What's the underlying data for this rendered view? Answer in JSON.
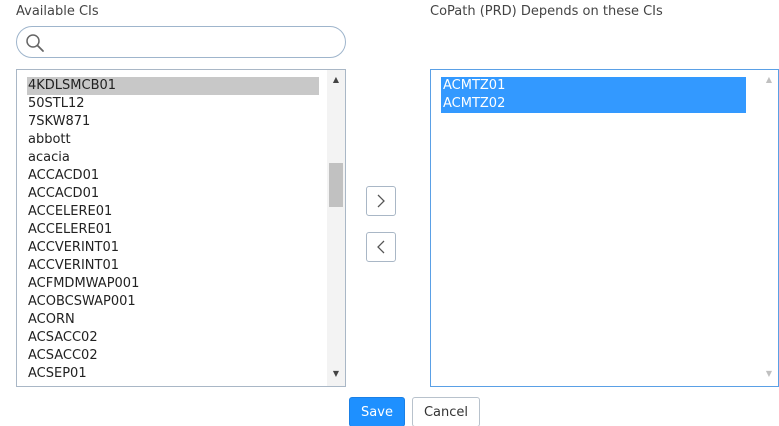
{
  "labels": {
    "available": "Available CIs",
    "depends": "CoPath (PRD) Depends on these CIs"
  },
  "search": {
    "value": "",
    "placeholder": ""
  },
  "available_list": [
    "4KDLSMCB01",
    "50STL12",
    "7SKW871",
    "abbott",
    "acacia",
    "ACCACD01",
    "ACCACD01",
    "ACCELERE01",
    "ACCELERE01",
    "ACCVERINT01",
    "ACCVERINT01",
    "ACFMDMWAP001",
    "ACOBCSWAP001",
    "ACORN",
    "ACSACC02",
    "ACSACC02",
    "ACSEP01"
  ],
  "selected_list": [
    "ACMTZ01",
    "ACMTZ02"
  ],
  "buttons": {
    "add": "›",
    "remove": "‹",
    "save": "Save",
    "cancel": "Cancel"
  },
  "colors": {
    "accent": "#1e90ff",
    "selection": "#3399ff",
    "highlight_gray": "#c8c8c8"
  }
}
